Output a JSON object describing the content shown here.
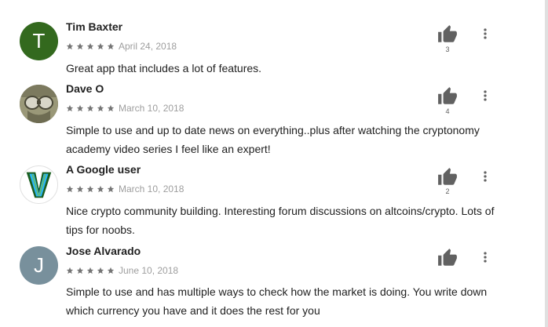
{
  "reviews": [
    {
      "author": "Tim Baxter",
      "initial": "T",
      "avatar_color": "#33691e",
      "stars": 5,
      "date": "April 24, 2018",
      "text": "Great app that includes a lot of features.",
      "helpful_count": "3"
    },
    {
      "author": "Dave O",
      "initial": "",
      "avatar_color": "#8d8b73",
      "stars": 5,
      "date": "March 10, 2018",
      "text": "Simple to use and up to date news on everything..plus after watching the cryptonomy academy video series I feel like an expert!",
      "helpful_count": "4"
    },
    {
      "author": "A Google user",
      "initial": "",
      "avatar_color": "#ffffff",
      "stars": 5,
      "date": "March 10, 2018",
      "text": "Nice crypto community building. Interesting forum discussions on altcoins/crypto. Lots of tips for noobs.",
      "helpful_count": "2"
    },
    {
      "author": "Jose Alvarado",
      "initial": "J",
      "avatar_color": "#78909c",
      "stars": 5,
      "date": "June 10, 2018",
      "text": "Simple to use and has multiple ways to check how the market is doing. You write down which currency you have and it does the rest for you",
      "helpful_count": ""
    }
  ],
  "icons": {
    "thumb": "thumb-up-icon",
    "more": "more-vert-icon",
    "star": "star-icon"
  },
  "colors": {
    "star": "#757575",
    "icon": "#616161"
  }
}
